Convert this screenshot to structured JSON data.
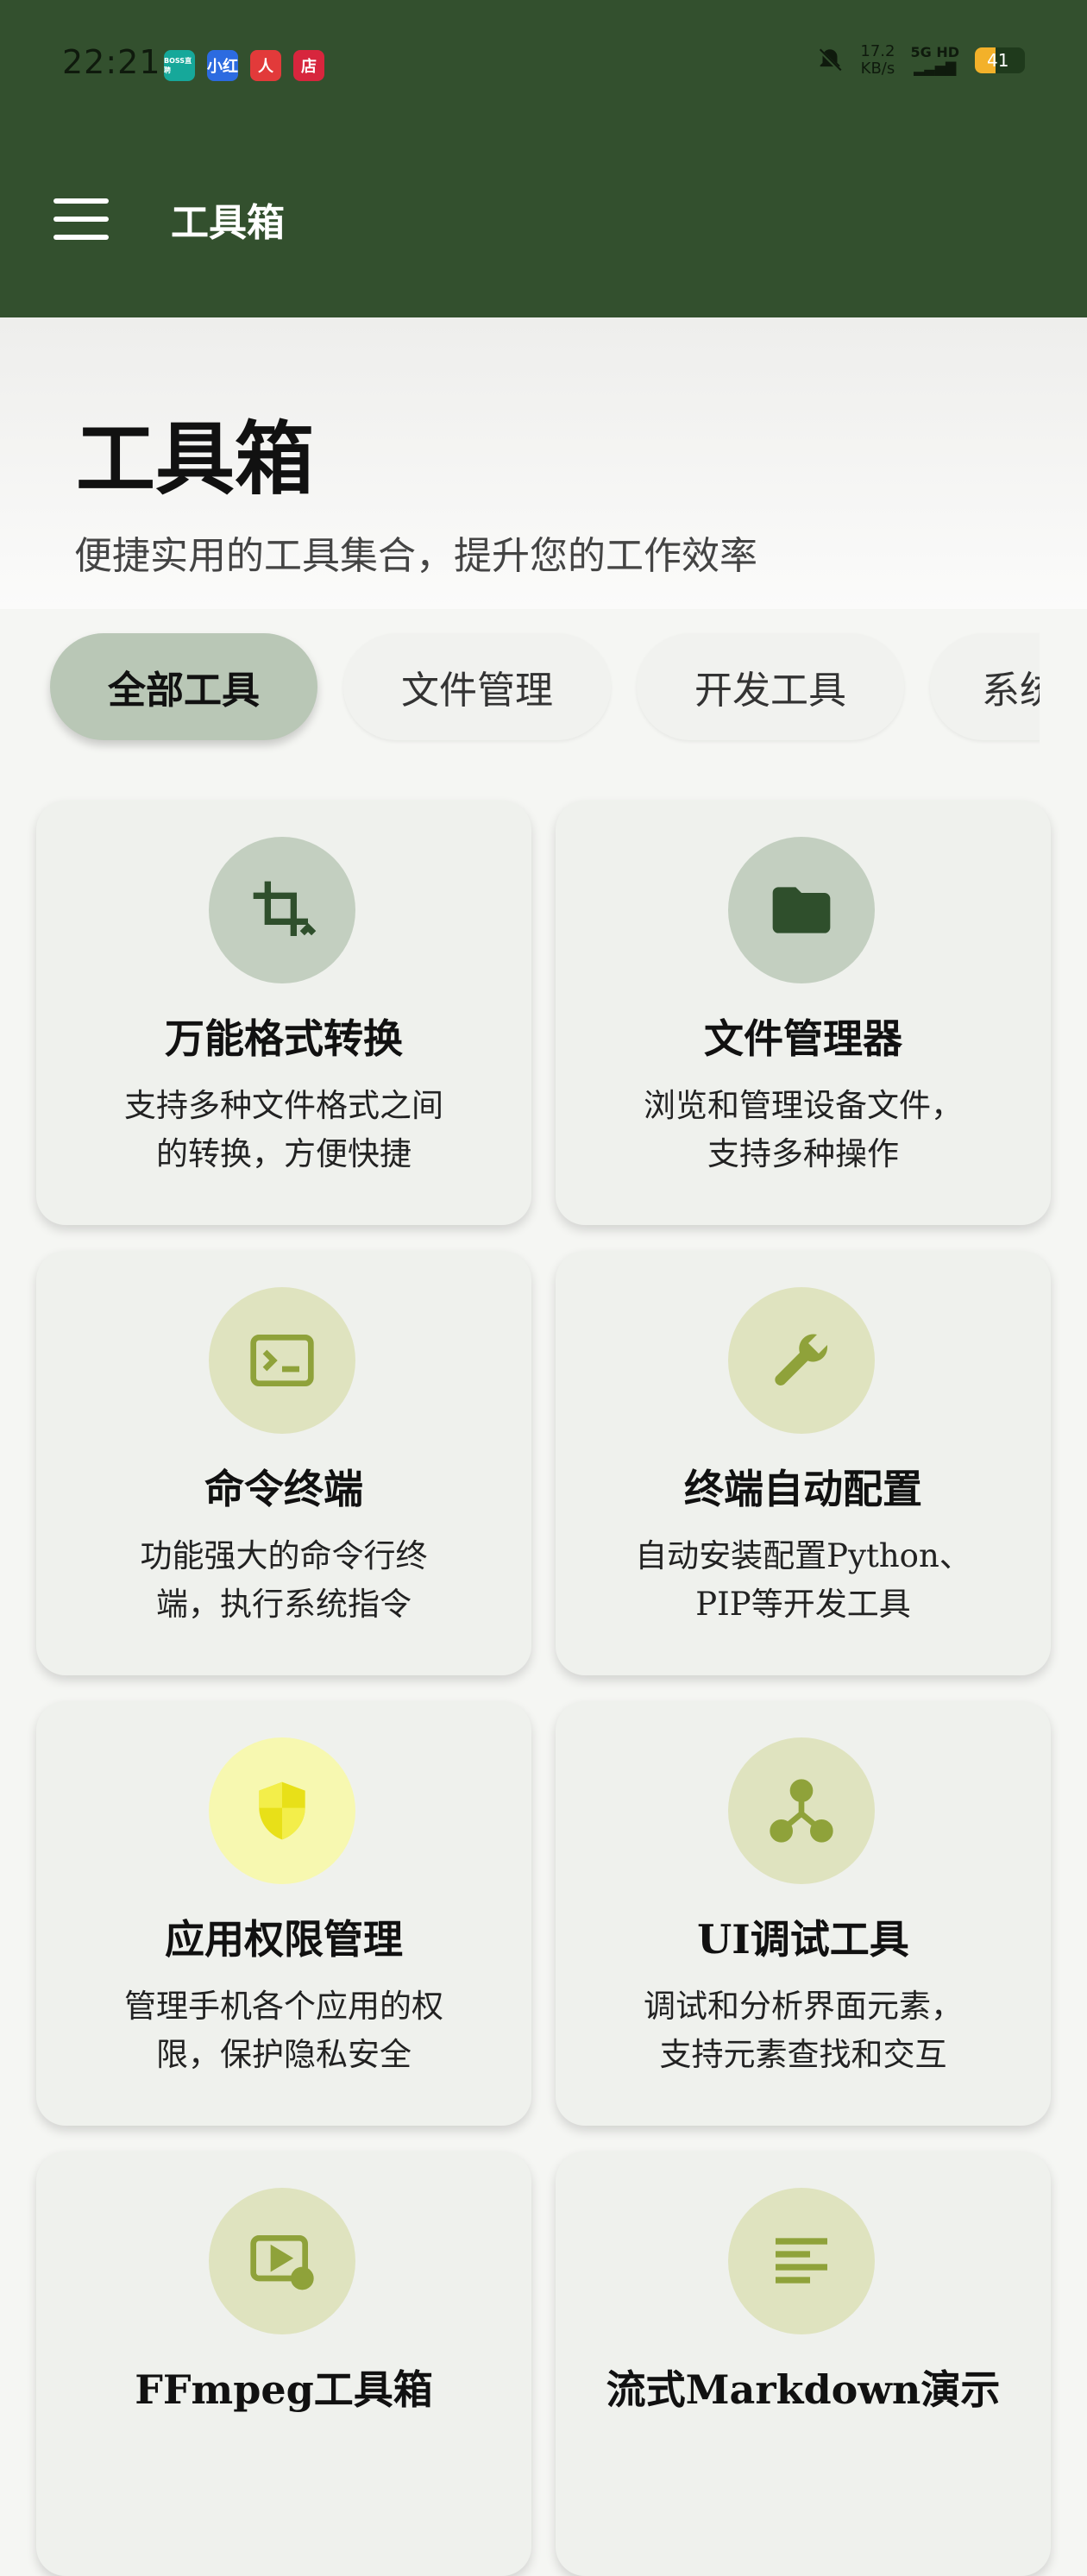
{
  "status_bar": {
    "time": "22:21",
    "apps": [
      {
        "label": "BOSS直聘",
        "color": "#16a89a"
      },
      {
        "label": "小红",
        "color": "#2c6be0"
      },
      {
        "label": "人",
        "color": "#e23a3a"
      },
      {
        "label": "店",
        "color": "#d7263d"
      }
    ],
    "net_speed": "17.2",
    "net_unit": "KB/s",
    "signal": "5G HD",
    "battery": "41"
  },
  "app_bar": {
    "title": "工具箱"
  },
  "hero": {
    "title": "工具箱",
    "subtitle": "便捷实用的工具集合，提升您的工作效率"
  },
  "tabs": [
    {
      "label": "全部工具",
      "active": true
    },
    {
      "label": "文件管理",
      "active": false
    },
    {
      "label": "开发工具",
      "active": false
    },
    {
      "label": "系统",
      "active": false
    }
  ],
  "tools": [
    {
      "title": "万能格式转换",
      "desc_lines": [
        "支持多种文件格式之间",
        "的转换，方便快捷"
      ],
      "icon": "crop-rotate-icon",
      "badge_color": "#c3cfc0",
      "icon_color": "#2f4f2c"
    },
    {
      "title": "文件管理器",
      "desc_lines": [
        "浏览和管理设备文件，",
        "支持多种操作"
      ],
      "icon": "folder-icon",
      "badge_color": "#c3cfc0",
      "icon_color": "#2f4f2c"
    },
    {
      "title": "命令终端",
      "desc_lines": [
        "功能强大的命令行终",
        "端，执行系统指令"
      ],
      "icon": "terminal-icon",
      "badge_color": "#dfe3bf",
      "icon_color": "#8fa23a"
    },
    {
      "title": "终端自动配置",
      "desc_lines": [
        "自动安装配置Python、",
        "PIP等开发工具"
      ],
      "icon": "wrench-icon",
      "badge_color": "#dfe3bf",
      "icon_color": "#8fa23a"
    },
    {
      "title": "应用权限管理",
      "desc_lines": [
        "管理手机各个应用的权",
        "限，保护隐私安全"
      ],
      "icon": "shield-icon",
      "badge_color": "#f7f8b0",
      "icon_color": "#e8e018"
    },
    {
      "title": "UI调试工具",
      "desc_lines": [
        "调试和分析界面元素，",
        "支持元素查找和交互"
      ],
      "icon": "hierarchy-icon",
      "badge_color": "#dfe3bf",
      "icon_color": "#8fa23a"
    },
    {
      "title": "FFmpeg工具箱",
      "desc_lines": [
        "",
        ""
      ],
      "icon": "video-settings-icon",
      "badge_color": "#dfe3bf",
      "icon_color": "#8fa23a"
    },
    {
      "title": "流式Markdown演示",
      "desc_lines": [
        "",
        ""
      ],
      "icon": "notes-icon",
      "badge_color": "#dfe3bf",
      "icon_color": "#8fa23a"
    }
  ]
}
